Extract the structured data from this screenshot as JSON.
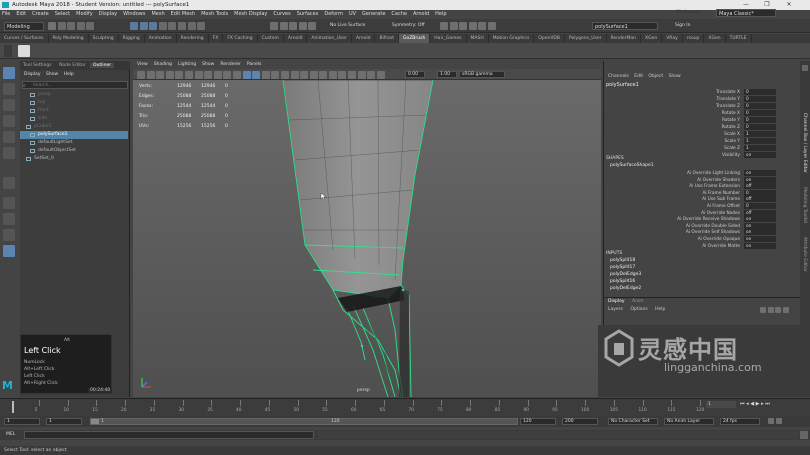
{
  "window": {
    "title": "Autodesk Maya 2018 - Student Version: untitled  ---  polySurface1",
    "minimize": "—",
    "maximize": "❐",
    "close": "✕"
  },
  "menus": [
    "File",
    "Edit",
    "Create",
    "Select",
    "Modify",
    "Display",
    "Windows",
    "Mesh",
    "Edit Mesh",
    "Mesh Tools",
    "Mesh Display",
    "Curves",
    "Surfaces",
    "Deform",
    "UV",
    "Generate",
    "Cache",
    "Arnold",
    "Help"
  ],
  "status_line": {
    "menu_set": "Modeling",
    "no_live_surface": "No Live Surface",
    "symmetry": "Symmetry: Off",
    "object_field": "polySurface1",
    "workspace_label": "Workspace :",
    "workspace_value": "Maya Classic*",
    "sign_in": "Sign In"
  },
  "shelf_tabs": [
    "Curves / Surfaces",
    "Poly Modeling",
    "Sculpting",
    "Rigging",
    "Animation",
    "Rendering",
    "FX",
    "FX Caching",
    "Custom",
    "Arnold",
    "Animation_User",
    "Arnold",
    "Bifrost",
    "GoZBrush",
    "Hair_Games",
    "MASH",
    "Motion Graphics",
    "OpenVDB",
    "Polygons_User",
    "RenderMan",
    "XGen",
    "VRay",
    "rsoup",
    "XGen",
    "TURTLE"
  ],
  "shelf_active_index": 13,
  "outliner": {
    "tabs": [
      "Tool Settings",
      "Node Editor",
      "Outliner"
    ],
    "active_tab": 2,
    "menu": [
      "Display",
      "Show",
      "Help"
    ],
    "search_placeholder": "Search...",
    "items": [
      {
        "label": "persp",
        "dim": true,
        "indent": 1
      },
      {
        "label": "top",
        "dim": true,
        "indent": 1
      },
      {
        "label": "front",
        "dim": true,
        "indent": 1
      },
      {
        "label": "side",
        "dim": true,
        "indent": 1
      },
      {
        "label": "pCube1",
        "dim": true,
        "indent": 0
      },
      {
        "label": "polySurface1",
        "dim": false,
        "indent": 1,
        "selected": true
      },
      {
        "label": "defaultLightSet",
        "dim": false,
        "indent": 1
      },
      {
        "label": "defaultObjectSet",
        "dim": false,
        "indent": 1
      },
      {
        "label": "SetSet_0",
        "dim": false,
        "indent": 0
      }
    ]
  },
  "keypress": {
    "modifier": "Alt",
    "headline": "Left Click",
    "lines": [
      "NumLock",
      "Alt+Left Click",
      "Left Click",
      "Alt+Right Click"
    ],
    "time": "00:24:40"
  },
  "viewport": {
    "menu": [
      "View",
      "Shading",
      "Lighting",
      "Show",
      "Renderer",
      "Panels"
    ],
    "field_a": "0.00",
    "field_b": "1.00",
    "colorspace": "sRGB gamma",
    "camera": "persp",
    "hud_rows": [
      {
        "label": "Verts:",
        "a": "12946",
        "b": "12946",
        "c": "0"
      },
      {
        "label": "Edges:",
        "a": "25088",
        "b": "25088",
        "c": "0"
      },
      {
        "label": "Faces:",
        "a": "12544",
        "b": "12544",
        "c": "0"
      },
      {
        "label": "Tris:",
        "a": "25088",
        "b": "25088",
        "c": "0"
      },
      {
        "label": "UVs:",
        "a": "15256",
        "b": "15256",
        "c": "0"
      }
    ]
  },
  "channel_box": {
    "menu": [
      "Channels",
      "Edit",
      "Object",
      "Show"
    ],
    "object_name": "polySurface1",
    "channels": [
      {
        "label": "Translate X",
        "value": "0"
      },
      {
        "label": "Translate Y",
        "value": "0"
      },
      {
        "label": "Translate Z",
        "value": "0"
      },
      {
        "label": "Rotate X",
        "value": "0"
      },
      {
        "label": "Rotate Y",
        "value": "0"
      },
      {
        "label": "Rotate Z",
        "value": "0"
      },
      {
        "label": "Scale X",
        "value": "1"
      },
      {
        "label": "Scale Y",
        "value": "1"
      },
      {
        "label": "Scale Z",
        "value": "1"
      },
      {
        "label": "Visibility",
        "value": "on"
      }
    ],
    "shapes_header": "SHAPES",
    "shape_name": "polySurfaceShape1",
    "shape_attrs": [
      {
        "label": "Ai Override Light Linking",
        "value": "on"
      },
      {
        "label": "Ai Override Shaders",
        "value": "on"
      },
      {
        "label": "Ai Use Frame Extension",
        "value": "off"
      },
      {
        "label": "Ai Frame Number",
        "value": "0"
      },
      {
        "label": "Ai Use Sub Frame",
        "value": "off"
      },
      {
        "label": "Ai Frame Offset",
        "value": "0"
      },
      {
        "label": "Ai Override Nodes",
        "value": "off"
      },
      {
        "label": "Ai Override Receive Shadows",
        "value": "on"
      },
      {
        "label": "Ai Override Double Sided",
        "value": "on"
      },
      {
        "label": "Ai Override Self Shadows",
        "value": "on"
      },
      {
        "label": "Ai Override Opaque",
        "value": "on"
      },
      {
        "label": "Ai Override Matte",
        "value": "on"
      }
    ],
    "inputs_header": "INPUTS",
    "inputs": [
      "polySplit18",
      "polySplit17",
      "polyDelEdge3",
      "polySplit16",
      "polyDelEdge2"
    ]
  },
  "layer_editor": {
    "tabs": [
      "Display",
      "Anim"
    ],
    "menu": [
      "Layers",
      "Options",
      "Help"
    ]
  },
  "side_tabs": [
    "Channel Box / Layer Editor",
    "Modeling Toolkit",
    "Attribute Editor"
  ],
  "timeline": {
    "ticks": [
      "5",
      "10",
      "15",
      "20",
      "25",
      "30",
      "35",
      "40",
      "45",
      "50",
      "55",
      "60",
      "65",
      "70",
      "75",
      "80",
      "85",
      "90",
      "95",
      "100",
      "105",
      "110",
      "115",
      "120"
    ],
    "current_frame": "1"
  },
  "range": {
    "start": "1",
    "start2": "1",
    "playback_start": "1",
    "playback_end": "120",
    "end": "120",
    "end2": "200",
    "no_character": "No Character Set",
    "no_anim_layer": "No Anim Layer",
    "fps": "24 fps"
  },
  "command_line": {
    "label": "MEL"
  },
  "help_line": "Select Tool: select an object",
  "watermark": {
    "cn": "灵感中国",
    "url": "lingganchina.com"
  },
  "colors": {
    "wire_highlight": "#2fe28a",
    "selection": "#5285a6",
    "viewport_bg": "#5e5e5e",
    "mesh_fill": "#8e8e8e"
  }
}
